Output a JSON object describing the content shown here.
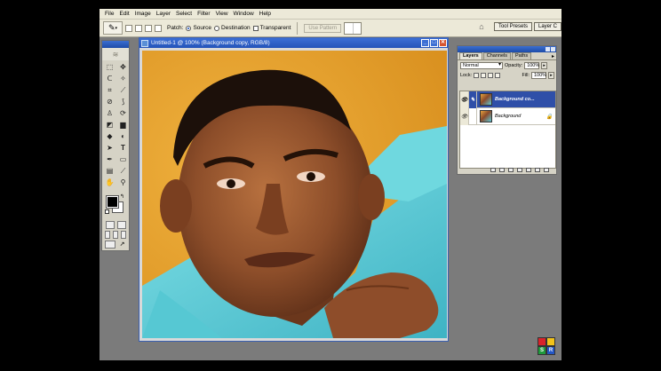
{
  "menu": [
    "File",
    "Edit",
    "Image",
    "Layer",
    "Select",
    "Filter",
    "View",
    "Window",
    "Help"
  ],
  "options": {
    "patch_label": "Patch:",
    "source_label": "Source",
    "destination_label": "Destination",
    "transparent_label": "Transparent",
    "use_pattern_label": "Use Pattern",
    "tool_presets_tab": "Tool Presets",
    "layer_comps_tab": "Layer C"
  },
  "document": {
    "title": "Untitled-1 @ 100% (Background copy, RGB/8)"
  },
  "layers_panel": {
    "tabs": [
      "Layers",
      "Channels",
      "Paths"
    ],
    "blend_mode": "Normal",
    "opacity_label": "Opacity:",
    "opacity_value": "100%",
    "lock_label": "Lock:",
    "fill_label": "Fill:",
    "fill_value": "100%",
    "layers": [
      {
        "name": "Background co...",
        "selected": true
      },
      {
        "name": "Background",
        "selected": false
      }
    ]
  },
  "icons": {
    "tools": [
      "marquee-icon",
      "move-icon",
      "lasso-icon",
      "magic-wand-icon",
      "crop-icon",
      "slice-icon",
      "healing-brush-icon",
      "brush-icon",
      "clone-stamp-icon",
      "history-brush-icon",
      "eraser-icon",
      "gradient-icon",
      "blur-icon",
      "dodge-icon",
      "path-selection-icon",
      "type-icon",
      "pen-icon",
      "shape-icon",
      "notes-icon",
      "eyedropper-icon",
      "hand-icon",
      "zoom-icon"
    ]
  },
  "logo": {
    "letters": [
      "",
      "",
      "S",
      "R"
    ],
    "colors": [
      "#d8232a",
      "#f2c31a",
      "#1f9a3c",
      "#2457c5"
    ]
  }
}
